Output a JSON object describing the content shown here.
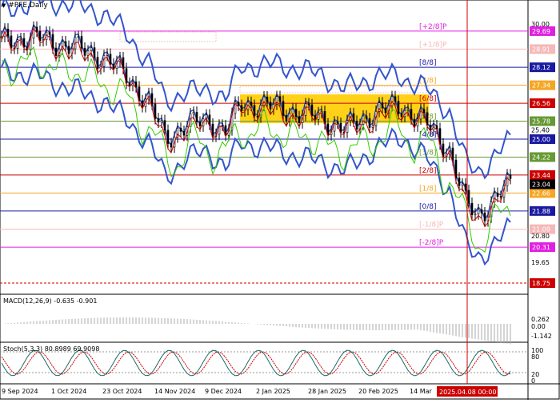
{
  "window": {
    "title": "#PFE,Daily",
    "menu_icon": "triangle-down-icon"
  },
  "main_panel": {
    "price_ticks": [
      "30.00",
      "28.91",
      "28.12",
      "27.34",
      "26.56",
      "25.78",
      "25.40",
      "25.00",
      "24.22",
      "23.44",
      "23.04",
      "22.66",
      "21.88",
      "21.09",
      "20.80",
      "20.31",
      "19.65",
      "18.75"
    ],
    "murrey_lines": [
      {
        "label": "[+2/8]P",
        "price": 29.69,
        "color": "#e020e0",
        "tag": "29.69"
      },
      {
        "label": "[+1/8]P",
        "price": 28.91,
        "color": "#f6b8b8",
        "tag": "28.91"
      },
      {
        "label": "[8/8]",
        "price": 28.12,
        "color": "#1a1aa0",
        "tag": "28.12"
      },
      {
        "label": "[7/8]",
        "price": 27.34,
        "color": "#f5a623",
        "tag": "27.34"
      },
      {
        "label": "[6/8]",
        "price": 26.56,
        "color": "#cc0000",
        "tag": "26.56"
      },
      {
        "label": "[5/8]",
        "price": 25.78,
        "color": "#669933",
        "tag": "25.78"
      },
      {
        "label": "[4/8]",
        "price": 25.0,
        "color": "#1a1aa0",
        "tag": "25.00"
      },
      {
        "label": "[3/8]",
        "price": 24.22,
        "color": "#669933",
        "tag": "24.22"
      },
      {
        "label": "[2/8]",
        "price": 23.44,
        "color": "#cc0000",
        "tag": "23.44"
      },
      {
        "label": "[1/8]",
        "price": 22.66,
        "color": "#f5a623",
        "tag": "22.66"
      },
      {
        "label": "[0/8]",
        "price": 21.88,
        "color": "#1a1aa0",
        "tag": "21.88"
      },
      {
        "label": "[-1/8]P",
        "price": 21.09,
        "color": "#f6b8b8",
        "tag": "21.09"
      },
      {
        "label": "[-2/8]P",
        "price": 20.31,
        "color": "#e020e0",
        "tag": "20.31"
      }
    ],
    "current_price": "23.04",
    "extra_tick": "18.75"
  },
  "macd_panel": {
    "label": "MACD(12,26,9) -0.635 -0.901",
    "ticks": [
      "0.262",
      "0.00",
      "-1.142"
    ]
  },
  "stoch_panel": {
    "label": "Stoch(5,3,3) 80.8989 69.9098",
    "ticks": [
      "100",
      "80",
      "20",
      "0"
    ]
  },
  "x_axis": {
    "labels": [
      "9 Sep 2024",
      "1 Oct 2024",
      "23 Oct 2024",
      "14 Nov 2024",
      "9 Dec 2024",
      "2 Jan 2025",
      "28 Jan 2025",
      "20 Feb 2025",
      "14 Mar"
    ],
    "cursor_label": "2025.04.08 00:00"
  },
  "colors": {
    "bollinger": "#3355cc",
    "ma_red": "#cc0000",
    "rsi_green": "#33cc00",
    "box_fill": "#ffcc00",
    "cursor": "#cc0000"
  },
  "chart_data": {
    "type": "line",
    "title": "#PFE,Daily",
    "ylim": [
      18.75,
      30.5
    ],
    "x": [
      "9 Sep 2024",
      "1 Oct 2024",
      "23 Oct 2024",
      "14 Nov 2024",
      "9 Dec 2024",
      "2 Jan 2025",
      "28 Jan 2025",
      "20 Feb 2025",
      "14 Mar 2025",
      "8 Apr 2025"
    ],
    "series": [
      {
        "values": [
          29.2,
          28.9,
          28.1,
          26.8,
          25.2,
          26.2,
          26.4,
          26.0,
          25.6,
          21.6,
          23.0
        ]
      }
    ]
  }
}
